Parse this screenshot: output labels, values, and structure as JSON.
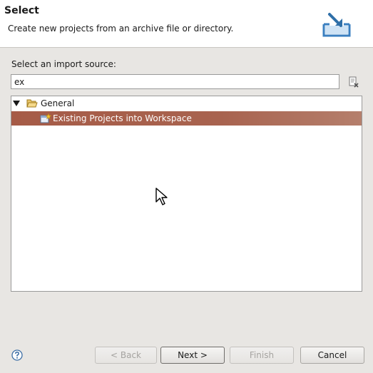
{
  "header": {
    "title": "Select",
    "description": "Create new projects from an archive file or directory."
  },
  "source_label": "Select an import source:",
  "filter": {
    "value": "ex"
  },
  "tree": {
    "items": [
      {
        "label": "General",
        "expanded": true,
        "icon": "folder-open-icon"
      },
      {
        "label": "Existing Projects into Workspace",
        "selected": true,
        "icon": "project-import-icon"
      }
    ]
  },
  "buttons": {
    "back": "< Back",
    "next": "Next >",
    "finish": "Finish",
    "cancel": "Cancel"
  },
  "colors": {
    "selection": "#a65b47",
    "dialog_bg": "#e8e6e3",
    "header_bg": "#ffffff"
  }
}
